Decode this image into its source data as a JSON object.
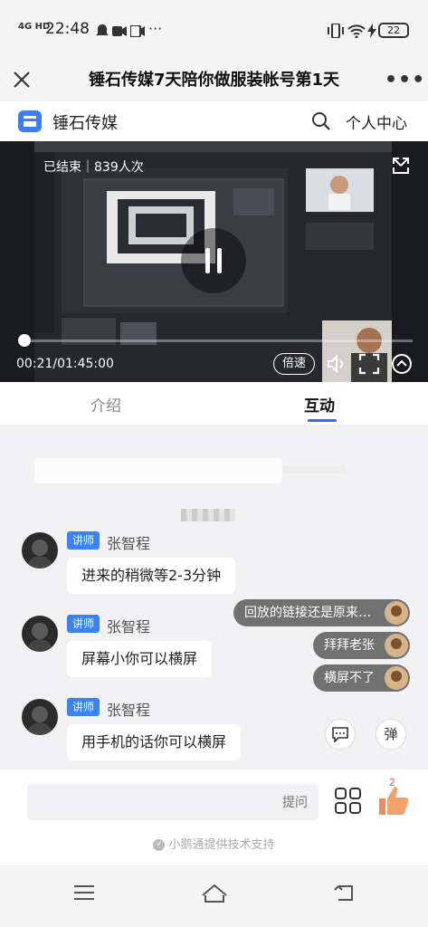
{
  "status_bar": {
    "network": "4G HD",
    "time": "22:48",
    "battery": "22"
  },
  "header": {
    "title": "锤石传媒7天陪你做服装帐号第1天"
  },
  "channel": {
    "name": "锤石传媒",
    "profile_link": "个人中心"
  },
  "video": {
    "status_text": "已结束｜839人次",
    "time_text": "00:21/01:45:00",
    "speed_label": "倍速",
    "progress": 0.003
  },
  "tabs": [
    {
      "label": "介绍",
      "active": false
    },
    {
      "label": "互动",
      "active": true
    }
  ],
  "messages": [
    {
      "role": "讲师",
      "sender": "张智程",
      "text": "进来的稍微等2-3分钟"
    },
    {
      "role": "讲师",
      "sender": "张智程",
      "text": "屏幕小你可以横屏"
    },
    {
      "role": "讲师",
      "sender": "张智程",
      "text": "用手机的话你可以横屏"
    }
  ],
  "danmaku": [
    {
      "text": "回放的链接还是原来…"
    },
    {
      "text": "拜拜老张"
    },
    {
      "text": "横屏不了"
    }
  ],
  "float_buttons": {
    "danmaku_label": "弹"
  },
  "input": {
    "placeholder": "提问",
    "like_count": "2"
  },
  "footer": {
    "powered_by": "小鹅通提供技术支持"
  },
  "colors": {
    "accent": "#2f6ef0",
    "badge": "#3b82f6",
    "like": "#f08a5d"
  }
}
